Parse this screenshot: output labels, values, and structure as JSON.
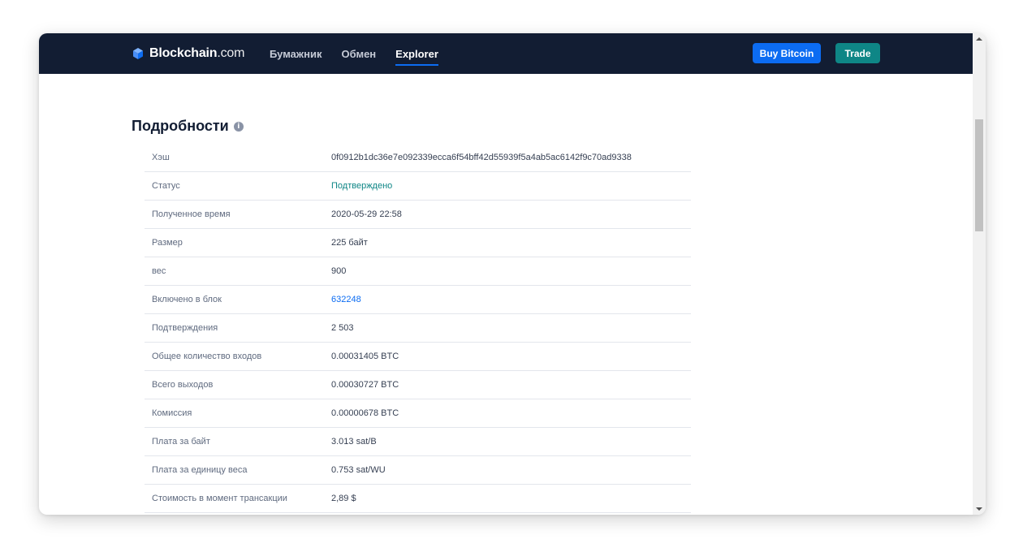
{
  "header": {
    "logo_text_main": "Blockchain",
    "logo_text_suffix": ".com",
    "nav": [
      {
        "label": "Бумажник",
        "active": false
      },
      {
        "label": "Обмен",
        "active": false
      },
      {
        "label": "Explorer",
        "active": true
      }
    ],
    "buy_label": "Buy Bitcoin",
    "trade_label": "Trade"
  },
  "details": {
    "title": "Подробности",
    "info_glyph": "i",
    "rows": [
      {
        "label": "Хэш",
        "value": "0f0912b1dc36e7e092339ecca6f54bff42d55939f5a4ab5ac6142f9c70ad9338",
        "kind": "text"
      },
      {
        "label": "Статус",
        "value": "Подтверждено",
        "kind": "status"
      },
      {
        "label": "Полученное время",
        "value": "2020-05-29 22:58",
        "kind": "text"
      },
      {
        "label": "Размер",
        "value": "225 байт",
        "kind": "text"
      },
      {
        "label": "вес",
        "value": "900",
        "kind": "text"
      },
      {
        "label": "Включено в блок",
        "value": "632248",
        "kind": "link"
      },
      {
        "label": "Подтверждения",
        "value": "2 503",
        "kind": "text"
      },
      {
        "label": "Общее количество входов",
        "value": "0.00031405 BTC",
        "kind": "text"
      },
      {
        "label": "Всего выходов",
        "value": "0.00030727 BTC",
        "kind": "text"
      },
      {
        "label": "Комиссия",
        "value": "0.00000678 BTC",
        "kind": "text"
      },
      {
        "label": "Плата за байт",
        "value": "3.013 sat/B",
        "kind": "text"
      },
      {
        "label": "Плата за единицу веса",
        "value": "0.753 sat/WU",
        "kind": "text"
      },
      {
        "label": "Стоимость в момент трансакции",
        "value": "2,89 $",
        "kind": "text"
      }
    ]
  },
  "colors": {
    "header_bg": "#121d33",
    "accent_blue": "#0c6cf2",
    "accent_teal": "#0e8686"
  }
}
